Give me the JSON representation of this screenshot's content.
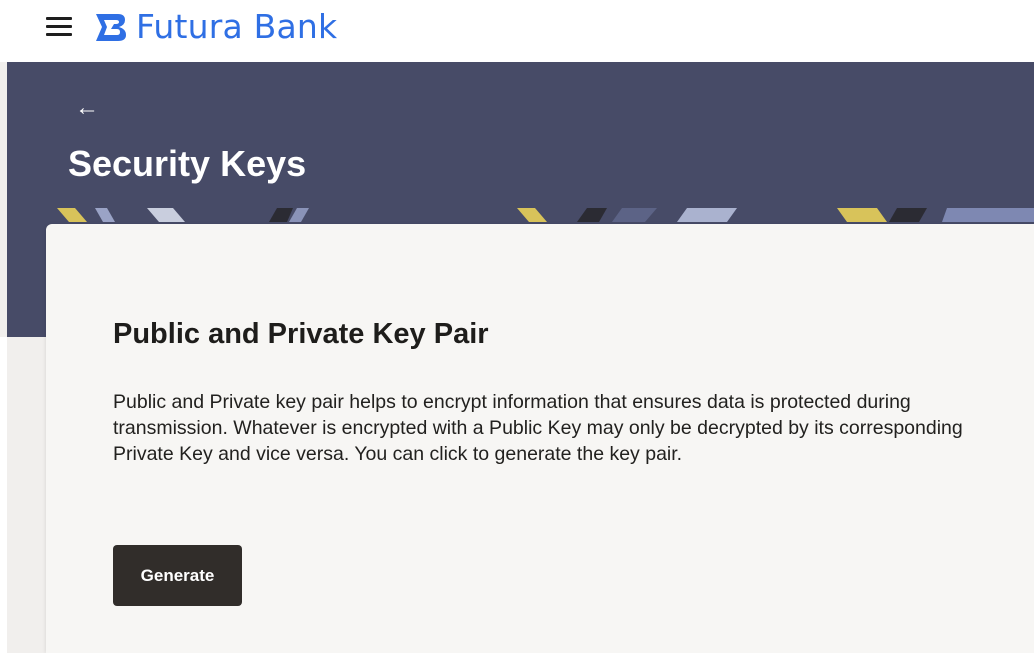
{
  "header": {
    "brand_name": "Futura Bank",
    "menu_icon": "hamburger-menu-icon",
    "logo_icon": "futura-logo-icon",
    "brand_color": "#2f6fe4"
  },
  "hero": {
    "back_icon": "back-arrow-icon",
    "back_glyph": "←",
    "title": "Security Keys",
    "background_color": "#474b67"
  },
  "card": {
    "title": "Public and Private Key Pair",
    "description": "Public and Private key pair helps to encrypt information that ensures data is protected during transmission. Whatever is encrypted with a Public Key may only be decrypted by its corresponding Private Key and vice versa. You can click to generate the key pair.",
    "generate_label": "Generate",
    "button_color": "#312d2a"
  }
}
